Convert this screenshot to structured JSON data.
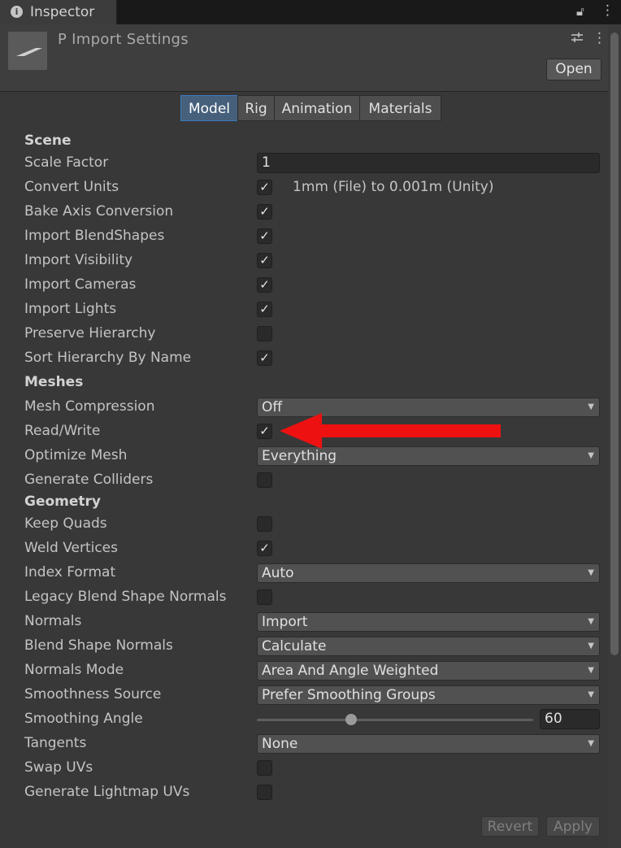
{
  "window": {
    "tab_title": "Inspector",
    "lock_icon": "lock-icon",
    "menu_icon": "kebab-menu-icon"
  },
  "header": {
    "asset_title": "P Import Settings",
    "open_label": "Open",
    "settings_icon": "sliders-icon",
    "kebab_icon": "kebab-menu-icon"
  },
  "tabs": [
    "Model",
    "Rig",
    "Animation",
    "Materials"
  ],
  "active_tab": "Model",
  "scene": {
    "heading": "Scene",
    "scale_factor_label": "Scale Factor",
    "scale_factor_value": "1",
    "convert_units_label": "Convert Units",
    "convert_units_note": "1mm (File) to 0.001m (Unity)",
    "bake_axis_label": "Bake Axis Conversion",
    "import_blendshapes_label": "Import BlendShapes",
    "import_visibility_label": "Import Visibility",
    "import_cameras_label": "Import Cameras",
    "import_lights_label": "Import Lights",
    "preserve_hierarchy_label": "Preserve Hierarchy",
    "sort_hierarchy_label": "Sort Hierarchy By Name"
  },
  "meshes": {
    "heading": "Meshes",
    "mesh_compression_label": "Mesh Compression",
    "mesh_compression_value": "Off",
    "read_write_label": "Read/Write",
    "optimize_mesh_label": "Optimize Mesh",
    "optimize_mesh_value": "Everything",
    "generate_colliders_label": "Generate Colliders"
  },
  "geometry": {
    "heading": "Geometry",
    "keep_quads_label": "Keep Quads",
    "weld_vertices_label": "Weld Vertices",
    "index_format_label": "Index Format",
    "index_format_value": "Auto",
    "legacy_blend_label": "Legacy Blend Shape Normals",
    "normals_label": "Normals",
    "normals_value": "Import",
    "blend_shape_normals_label": "Blend Shape Normals",
    "blend_shape_normals_value": "Calculate",
    "normals_mode_label": "Normals Mode",
    "normals_mode_value": "Area And Angle Weighted",
    "smoothness_source_label": "Smoothness Source",
    "smoothness_source_value": "Prefer Smoothing Groups",
    "smoothing_angle_label": "Smoothing Angle",
    "smoothing_angle_value": "60",
    "tangents_label": "Tangents",
    "tangents_value": "None",
    "swap_uvs_label": "Swap UVs",
    "lightmap_uvs_label": "Generate Lightmap UVs"
  },
  "checkmark": "✓",
  "footer": {
    "revert_label": "Revert",
    "apply_label": "Apply"
  },
  "colors": {
    "annotation_arrow": "#ee1111",
    "active_tab": "#46607c",
    "background": "#383838"
  }
}
